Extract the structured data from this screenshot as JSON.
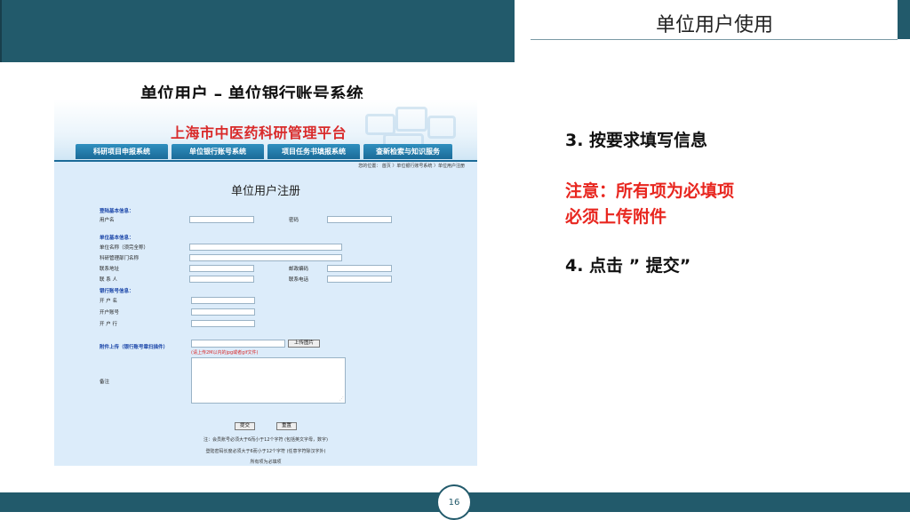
{
  "slide": {
    "title": "单位用户使用",
    "heading": "单位用户 – 单位银行账号系统",
    "page_number": "16"
  },
  "instructions": {
    "step3": "3. 按要求填写信息",
    "warning1": "注意：所有项为必填项",
    "warning2": "必须上传附件",
    "step4": "4. 点击 ” 提交”"
  },
  "screenshot": {
    "site_title": "上海市中医药科研管理平台",
    "nav": [
      "科研项目申报系统",
      "单位银行账号系统",
      "项目任务书填报系统",
      "查新检索与知识服务"
    ],
    "breadcrumb": "您的位置： 首页 〉单位银行账号系统 〉单位用户注册",
    "form_title": "单位用户注册",
    "sections": {
      "login": "登陆基本信息：",
      "unit": "单位基本信息：",
      "bank": "银行账号信息："
    },
    "labels": {
      "username": "用户名",
      "password": "密码",
      "unit_name": "单位名称（须完全称）",
      "dept": "科研管理部门名称",
      "address": "联系地址",
      "postcode": "邮政编码",
      "contact": "联 系 人",
      "phone": "联系电话",
      "account_name": "开 户 名",
      "account_no": "开户账号",
      "bank": "开 户 行",
      "attachment": "附件上传（银行账号章扫描件）",
      "remark": "备注"
    },
    "upload_button": "上传图片",
    "upload_hint": "(请上传2M以内的jpg或者gif文件)",
    "submit_button": "提交",
    "reset_button": "重置",
    "notes": [
      "注：会员账号必须大于6而小于12个字符 (包括英文字母，数字)",
      "登陆密码长度必须大于6而小于12个字符 (任意字符除汉字外)",
      "所有项为必填项"
    ]
  },
  "colors": {
    "theme": "#225a6b",
    "warning": "#e8261f",
    "site_title": "#d92b2b",
    "section_label": "#1a45a8"
  }
}
